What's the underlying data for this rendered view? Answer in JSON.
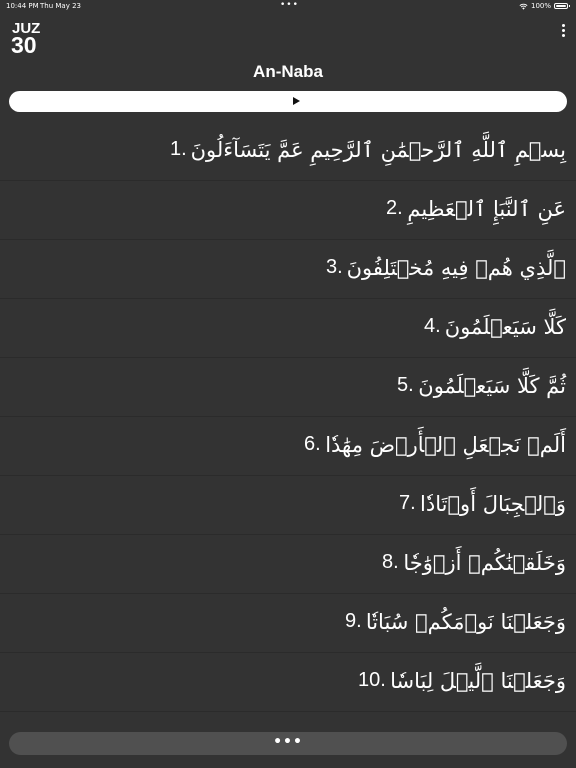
{
  "status_bar": {
    "time": "10:44 PM",
    "date": "Thu May 23",
    "battery": "100%",
    "center_dots": "•••"
  },
  "header": {
    "juz_label": "JUZ",
    "juz_number": "30",
    "title": "An-Naba"
  },
  "icons": {
    "menu": "vertical-ellipsis-icon",
    "play": "play-icon",
    "wifi": "wifi-icon",
    "battery": "battery-icon"
  },
  "verses": [
    {
      "num": "1.",
      "text": "بِسۡمِ ٱللَّهِ ٱلرَّحۡمَٰنِ ٱلرَّحِيمِ عَمَّ يَتَسَآءَلُونَ"
    },
    {
      "num": "2.",
      "text": "عَنِ ٱلنَّبَإِ ٱلۡعَظِيمِ"
    },
    {
      "num": "3.",
      "text": "ٱلَّذِي هُمۡ فِيهِ مُخۡتَلِفُونَ"
    },
    {
      "num": "4.",
      "text": "كَلَّا سَيَعۡلَمُونَ"
    },
    {
      "num": "5.",
      "text": "ثُمَّ كَلَّا سَيَعۡلَمُونَ"
    },
    {
      "num": "6.",
      "text": "أَلَمۡ نَجۡعَلِ ٱلۡأَرۡضَ مِهَٰدٗا"
    },
    {
      "num": "7.",
      "text": "وَٱلۡجِبَالَ أَوۡتَادٗا"
    },
    {
      "num": "8.",
      "text": "وَخَلَقۡنَٰكُمۡ أَزۡوَٰجٗا"
    },
    {
      "num": "9.",
      "text": "وَجَعَلۡنَا نَوۡمَكُمۡ سُبَاتٗا"
    },
    {
      "num": "10.",
      "text": "وَجَعَلۡنَا ٱلَّيۡلَ لِبَاسٗا"
    }
  ],
  "more_button": {
    "label": "•••"
  },
  "colors": {
    "background": "#333333",
    "text": "#ffffff",
    "play_bar": "#ffffff",
    "more_bar": "#505050"
  }
}
